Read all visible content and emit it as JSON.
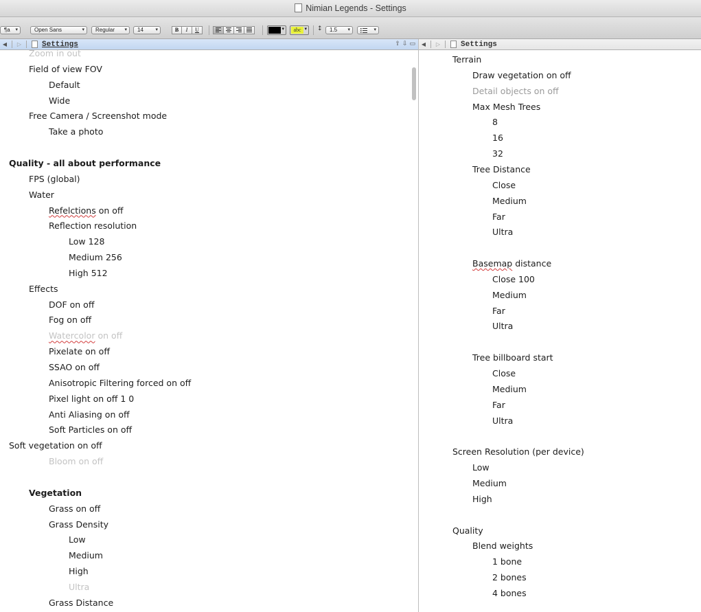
{
  "window": {
    "title": "Nimian Legends - Settings"
  },
  "toolbar": {
    "paragraph_style": "¶a",
    "font_family": "Open Sans",
    "font_style": "Regular",
    "font_size": "14",
    "bold": "B",
    "italic": "I",
    "underline": "U",
    "text_color": "#000000",
    "highlight_label": "abc",
    "highlight_color": "#e9f23a",
    "line_spacing": "1.5"
  },
  "left_pane": {
    "breadcrumb": "Settings",
    "lines": [
      {
        "text": "Zoom in out",
        "indent": 1,
        "style": "faint"
      },
      {
        "text": "Field of view FOV",
        "indent": 1
      },
      {
        "text": "Default",
        "indent": 2
      },
      {
        "text": "Wide",
        "indent": 2
      },
      {
        "text": "Free Camera / Screenshot mode",
        "indent": 1
      },
      {
        "text": "Take a photo",
        "indent": 2
      },
      {
        "text": "",
        "indent": 0
      },
      {
        "text": "Quality - all about performance",
        "indent": 0,
        "style": "bold"
      },
      {
        "text": "FPS (global)",
        "indent": 1
      },
      {
        "text": "Water",
        "indent": 1
      },
      {
        "text": "Refelctions on off",
        "indent": 2,
        "squiggle": "Refelctions"
      },
      {
        "text": "Reflection resolution",
        "indent": 2
      },
      {
        "text": "Low 128",
        "indent": 3
      },
      {
        "text": "Medium  256",
        "indent": 3
      },
      {
        "text": "High 512",
        "indent": 3
      },
      {
        "text": "Effects",
        "indent": 1
      },
      {
        "text": "DOF on off",
        "indent": 2
      },
      {
        "text": "Fog on off",
        "indent": 2
      },
      {
        "text": "Watercolor on off",
        "indent": 2,
        "style": "faint",
        "squiggle": "Watercolor"
      },
      {
        "text": "Pixelate on off",
        "indent": 2
      },
      {
        "text": "SSAO on off",
        "indent": 2
      },
      {
        "text": "Anisotropic Filtering forced on off",
        "indent": 2
      },
      {
        "text": "Pixel light on off 1 0",
        "indent": 2
      },
      {
        "text": "Anti Aliasing on off",
        "indent": 2
      },
      {
        "text": "Soft Particles on off",
        "indent": 2
      },
      {
        "text": "Soft vegetation on off",
        "indent": 0
      },
      {
        "text": "Bloom on off",
        "indent": 2,
        "style": "faint"
      },
      {
        "text": "",
        "indent": 0
      },
      {
        "text": "Vegetation",
        "indent": 1,
        "style": "bold"
      },
      {
        "text": "Grass on off",
        "indent": 2
      },
      {
        "text": "Grass Density",
        "indent": 2
      },
      {
        "text": "Low",
        "indent": 3
      },
      {
        "text": "Medium",
        "indent": 3
      },
      {
        "text": "High",
        "indent": 3
      },
      {
        "text": "Ultra",
        "indent": 3,
        "style": "faint"
      },
      {
        "text": "Grass Distance",
        "indent": 2
      }
    ]
  },
  "right_pane": {
    "breadcrumb": "Settings",
    "lines": [
      {
        "text": "Terrain",
        "indent": 0
      },
      {
        "text": "Draw vegetation on off",
        "indent": 1
      },
      {
        "text": "Detail objects on off",
        "indent": 1,
        "style": "dim"
      },
      {
        "text": "Max Mesh Trees",
        "indent": 1
      },
      {
        "text": "8",
        "indent": 2
      },
      {
        "text": "16",
        "indent": 2
      },
      {
        "text": "32",
        "indent": 2
      },
      {
        "text": "Tree Distance",
        "indent": 1
      },
      {
        "text": "Close",
        "indent": 2
      },
      {
        "text": "Medium",
        "indent": 2
      },
      {
        "text": "Far",
        "indent": 2
      },
      {
        "text": "Ultra",
        "indent": 2
      },
      {
        "text": "",
        "indent": 0
      },
      {
        "text": "Basemap distance",
        "indent": 1,
        "squiggle": "Basemap"
      },
      {
        "text": "Close 100",
        "indent": 2
      },
      {
        "text": "Medium",
        "indent": 2
      },
      {
        "text": "Far",
        "indent": 2
      },
      {
        "text": "Ultra",
        "indent": 2
      },
      {
        "text": "",
        "indent": 0
      },
      {
        "text": "Tree billboard start",
        "indent": 1
      },
      {
        "text": "Close",
        "indent": 2
      },
      {
        "text": "Medium",
        "indent": 2
      },
      {
        "text": "Far",
        "indent": 2
      },
      {
        "text": "Ultra",
        "indent": 2
      },
      {
        "text": "",
        "indent": 0
      },
      {
        "text": "Screen Resolution (per device)",
        "indent": 0
      },
      {
        "text": "Low",
        "indent": 1
      },
      {
        "text": "Medium",
        "indent": 1
      },
      {
        "text": "High",
        "indent": 1
      },
      {
        "text": "",
        "indent": 0
      },
      {
        "text": "Quality",
        "indent": 0
      },
      {
        "text": "Blend weights",
        "indent": 1
      },
      {
        "text": "1 bone",
        "indent": 2
      },
      {
        "text": "2 bones",
        "indent": 2
      },
      {
        "text": "4 bones",
        "indent": 2
      }
    ]
  }
}
